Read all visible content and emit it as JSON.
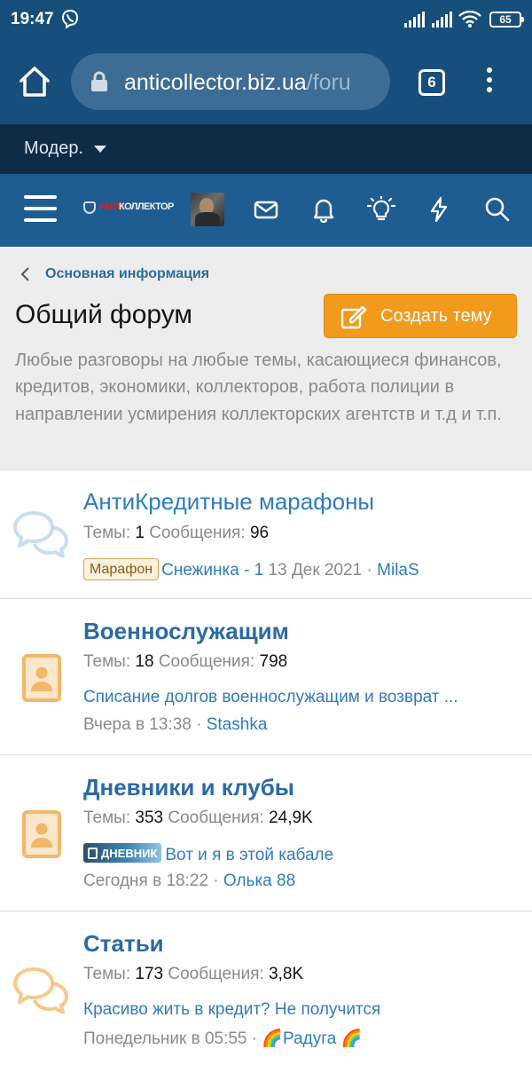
{
  "status_bar": {
    "time": "19:47",
    "battery": "65"
  },
  "browser": {
    "url_host": "anticollector.biz.ua",
    "url_path": "/foru",
    "tab_count": "6"
  },
  "mod_bar": {
    "label": "Модер."
  },
  "site": {
    "logo_anti": "АНТИ",
    "logo_kollektor": "КОЛЛЕКТОР"
  },
  "breadcrumb": {
    "label": "Основная информация"
  },
  "page": {
    "title": "Общий форум",
    "create_button": "Создать тему",
    "description": "Любые разговоры на любые темы, касающиеся финансов, кредитов, экономики, коллекторов, работа полиции в направлении усмирения коллекторских агентств и т.д и т.п."
  },
  "nodes": [
    {
      "title": "АнтиКредитные марафоны",
      "threads_label": "Темы:",
      "threads": "1",
      "messages_label": "Сообщения:",
      "messages": "96",
      "prefix": "Марафон",
      "last_thread": "Снежинка - 1",
      "last_date": "13 Дек 2021",
      "sep": "·",
      "last_user": "MilaS"
    },
    {
      "title": "Военнослужащим",
      "threads_label": "Темы:",
      "threads": "18",
      "messages_label": "Сообщения:",
      "messages": "798",
      "last_thread": "Списание долгов военнослужащим и возврат ...",
      "last_date": "Вчера в 13:38",
      "sep": "·",
      "last_user": "Stashka"
    },
    {
      "title": "Дневники и клубы",
      "threads_label": "Темы:",
      "threads": "353",
      "messages_label": "Сообщения:",
      "messages": "24,9K",
      "prefix": "ДНЕВНИК",
      "last_thread": "Вот и я в этой кабале",
      "last_date": "Сегодня в 18:22",
      "sep": "·",
      "last_user": "Олька 88"
    },
    {
      "title": "Статьи",
      "threads_label": "Темы:",
      "threads": "173",
      "messages_label": "Сообщения:",
      "messages": "3,8K",
      "last_thread": "Красиво жить в кредит? Не получится",
      "last_date": "Понедельник в 05:55",
      "sep": "·",
      "last_user": "🌈Радуга 🌈"
    }
  ],
  "colors": {
    "browser_bar": "#174e7b",
    "mod_bar": "#0f2c46",
    "site_nav": "#1f5c92",
    "accent_button": "#f29a1c",
    "link": "#2f7bc0"
  },
  "icons": {
    "status": [
      "viber-icon",
      "signal-icon",
      "wifi-icon",
      "battery-icon"
    ],
    "browser": [
      "home-icon",
      "lock-icon",
      "tabs-icon",
      "menu-dots-icon"
    ],
    "nav": [
      "hamburger-icon",
      "mail-icon",
      "bell-icon",
      "bulb-icon",
      "lightning-icon",
      "search-icon"
    ],
    "nodes": [
      "chat-bubbles-icon",
      "contact-card-icon",
      "contact-card-icon",
      "chat-bubbles-icon"
    ]
  }
}
